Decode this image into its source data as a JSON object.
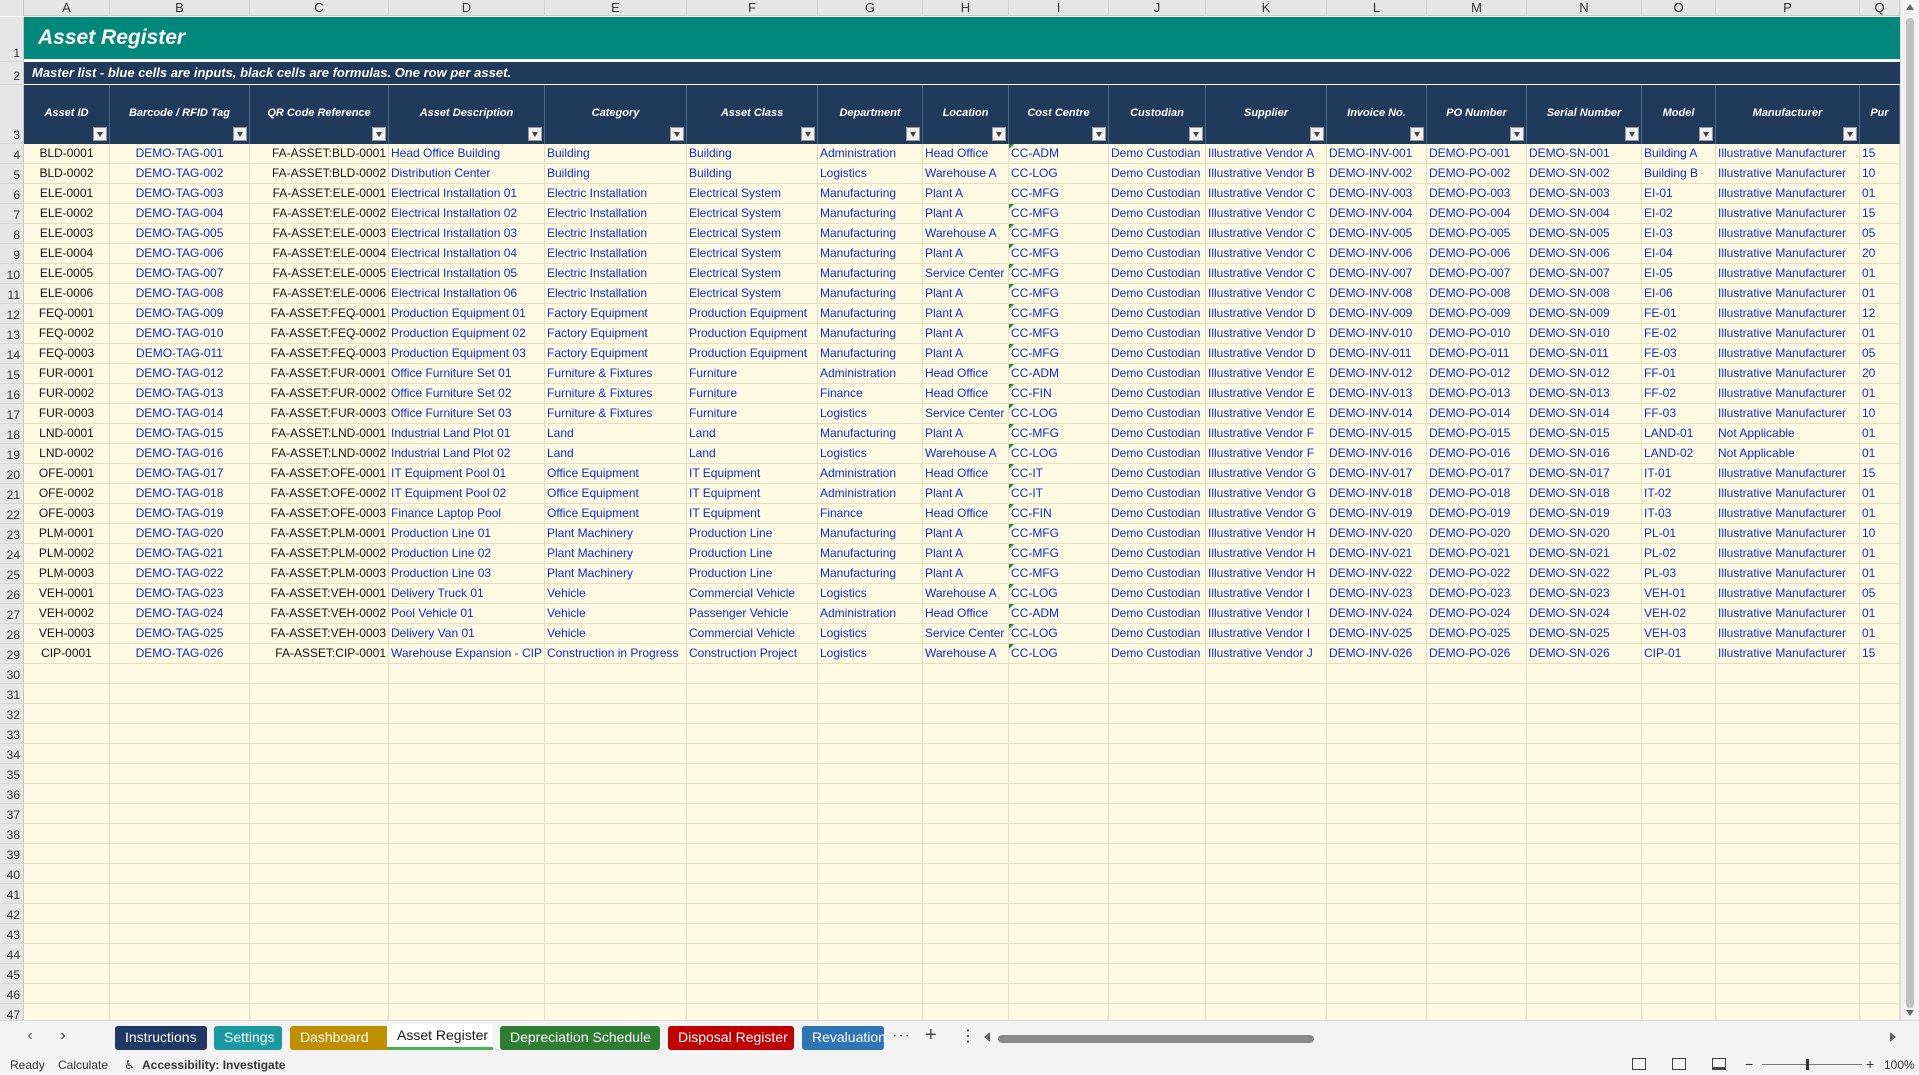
{
  "sheet": {
    "title": "Asset Register",
    "subtitle": "Master list - blue cells are inputs, black cells are formulas. One row per asset.",
    "column_letters": [
      "A",
      "B",
      "C",
      "D",
      "E",
      "F",
      "G",
      "H",
      "I",
      "J",
      "K",
      "L",
      "M",
      "N",
      "O",
      "P",
      "Q"
    ],
    "headers": [
      "Asset ID",
      "Barcode / RFID Tag",
      "QR Code Reference",
      "Asset Description",
      "Category",
      "Asset Class",
      "Department",
      "Location",
      "Cost Centre",
      "Custodian",
      "Supplier",
      "Invoice No.",
      "PO Number",
      "Serial Number",
      "Model",
      "Manufacturer",
      "Pur"
    ],
    "row_numbers": [
      "1",
      "2",
      "3",
      "4",
      "5",
      "6",
      "7",
      "8",
      "9",
      "10",
      "11",
      "12",
      "13",
      "14",
      "15",
      "16",
      "17",
      "18",
      "19",
      "20",
      "21",
      "22",
      "23",
      "24",
      "25",
      "26",
      "27",
      "28",
      "29",
      "30",
      "31",
      "32",
      "33",
      "34",
      "35",
      "36",
      "37",
      "38",
      "39",
      "40",
      "41",
      "42",
      "43",
      "44",
      "45",
      "46",
      "47"
    ],
    "rows": [
      [
        "BLD-0001",
        "DEMO-TAG-001",
        "FA-ASSET:BLD-0001",
        "Head Office Building",
        "Building",
        "Building",
        "Administration",
        "Head Office",
        "CC-ADM",
        "Demo Custodian",
        "Illustrative Vendor A",
        "DEMO-INV-001",
        "DEMO-PO-001",
        "DEMO-SN-001",
        "Building A",
        "Illustrative Manufacturer",
        "15"
      ],
      [
        "BLD-0002",
        "DEMO-TAG-002",
        "FA-ASSET:BLD-0002",
        "Distribution Center",
        "Building",
        "Building",
        "Logistics",
        "Warehouse A",
        "CC-LOG",
        "Demo Custodian",
        "Illustrative Vendor B",
        "DEMO-INV-002",
        "DEMO-PO-002",
        "DEMO-SN-002",
        "Building B",
        "Illustrative Manufacturer",
        "10"
      ],
      [
        "ELE-0001",
        "DEMO-TAG-003",
        "FA-ASSET:ELE-0001",
        "Electrical Installation 01",
        "Electric Installation",
        "Electrical System",
        "Manufacturing",
        "Plant A",
        "CC-MFG",
        "Demo Custodian",
        "Illustrative Vendor C",
        "DEMO-INV-003",
        "DEMO-PO-003",
        "DEMO-SN-003",
        "EI-01",
        "Illustrative Manufacturer",
        "01"
      ],
      [
        "ELE-0002",
        "DEMO-TAG-004",
        "FA-ASSET:ELE-0002",
        "Electrical Installation 02",
        "Electric Installation",
        "Electrical System",
        "Manufacturing",
        "Plant A",
        "CC-MFG",
        "Demo Custodian",
        "Illustrative Vendor C",
        "DEMO-INV-004",
        "DEMO-PO-004",
        "DEMO-SN-004",
        "EI-02",
        "Illustrative Manufacturer",
        "15"
      ],
      [
        "ELE-0003",
        "DEMO-TAG-005",
        "FA-ASSET:ELE-0003",
        "Electrical Installation 03",
        "Electric Installation",
        "Electrical System",
        "Manufacturing",
        "Warehouse A",
        "CC-MFG",
        "Demo Custodian",
        "Illustrative Vendor C",
        "DEMO-INV-005",
        "DEMO-PO-005",
        "DEMO-SN-005",
        "EI-03",
        "Illustrative Manufacturer",
        "05"
      ],
      [
        "ELE-0004",
        "DEMO-TAG-006",
        "FA-ASSET:ELE-0004",
        "Electrical Installation 04",
        "Electric Installation",
        "Electrical System",
        "Manufacturing",
        "Plant A",
        "CC-MFG",
        "Demo Custodian",
        "Illustrative Vendor C",
        "DEMO-INV-006",
        "DEMO-PO-006",
        "DEMO-SN-006",
        "EI-04",
        "Illustrative Manufacturer",
        "20"
      ],
      [
        "ELE-0005",
        "DEMO-TAG-007",
        "FA-ASSET:ELE-0005",
        "Electrical Installation 05",
        "Electric Installation",
        "Electrical System",
        "Manufacturing",
        "Service Center",
        "CC-MFG",
        "Demo Custodian",
        "Illustrative Vendor C",
        "DEMO-INV-007",
        "DEMO-PO-007",
        "DEMO-SN-007",
        "EI-05",
        "Illustrative Manufacturer",
        "01"
      ],
      [
        "ELE-0006",
        "DEMO-TAG-008",
        "FA-ASSET:ELE-0006",
        "Electrical Installation 06",
        "Electric Installation",
        "Electrical System",
        "Manufacturing",
        "Plant A",
        "CC-MFG",
        "Demo Custodian",
        "Illustrative Vendor C",
        "DEMO-INV-008",
        "DEMO-PO-008",
        "DEMO-SN-008",
        "EI-06",
        "Illustrative Manufacturer",
        "01"
      ],
      [
        "FEQ-0001",
        "DEMO-TAG-009",
        "FA-ASSET:FEQ-0001",
        "Production Equipment 01",
        "Factory Equipment",
        "Production Equipment",
        "Manufacturing",
        "Plant A",
        "CC-MFG",
        "Demo Custodian",
        "Illustrative Vendor D",
        "DEMO-INV-009",
        "DEMO-PO-009",
        "DEMO-SN-009",
        "FE-01",
        "Illustrative Manufacturer",
        "12"
      ],
      [
        "FEQ-0002",
        "DEMO-TAG-010",
        "FA-ASSET:FEQ-0002",
        "Production Equipment 02",
        "Factory Equipment",
        "Production Equipment",
        "Manufacturing",
        "Plant A",
        "CC-MFG",
        "Demo Custodian",
        "Illustrative Vendor D",
        "DEMO-INV-010",
        "DEMO-PO-010",
        "DEMO-SN-010",
        "FE-02",
        "Illustrative Manufacturer",
        "01"
      ],
      [
        "FEQ-0003",
        "DEMO-TAG-011",
        "FA-ASSET:FEQ-0003",
        "Production Equipment 03",
        "Factory Equipment",
        "Production Equipment",
        "Manufacturing",
        "Plant A",
        "CC-MFG",
        "Demo Custodian",
        "Illustrative Vendor D",
        "DEMO-INV-011",
        "DEMO-PO-011",
        "DEMO-SN-011",
        "FE-03",
        "Illustrative Manufacturer",
        "05"
      ],
      [
        "FUR-0001",
        "DEMO-TAG-012",
        "FA-ASSET:FUR-0001",
        "Office Furniture Set 01",
        "Furniture & Fixtures",
        "Furniture",
        "Administration",
        "Head Office",
        "CC-ADM",
        "Demo Custodian",
        "Illustrative Vendor E",
        "DEMO-INV-012",
        "DEMO-PO-012",
        "DEMO-SN-012",
        "FF-01",
        "Illustrative Manufacturer",
        "20"
      ],
      [
        "FUR-0002",
        "DEMO-TAG-013",
        "FA-ASSET:FUR-0002",
        "Office Furniture Set 02",
        "Furniture & Fixtures",
        "Furniture",
        "Finance",
        "Head Office",
        "CC-FIN",
        "Demo Custodian",
        "Illustrative Vendor E",
        "DEMO-INV-013",
        "DEMO-PO-013",
        "DEMO-SN-013",
        "FF-02",
        "Illustrative Manufacturer",
        "01"
      ],
      [
        "FUR-0003",
        "DEMO-TAG-014",
        "FA-ASSET:FUR-0003",
        "Office Furniture Set 03",
        "Furniture & Fixtures",
        "Furniture",
        "Logistics",
        "Service Center",
        "CC-LOG",
        "Demo Custodian",
        "Illustrative Vendor E",
        "DEMO-INV-014",
        "DEMO-PO-014",
        "DEMO-SN-014",
        "FF-03",
        "Illustrative Manufacturer",
        "10"
      ],
      [
        "LND-0001",
        "DEMO-TAG-015",
        "FA-ASSET:LND-0001",
        "Industrial Land Plot 01",
        "Land",
        "Land",
        "Manufacturing",
        "Plant A",
        "CC-MFG",
        "Demo Custodian",
        "Illustrative Vendor F",
        "DEMO-INV-015",
        "DEMO-PO-015",
        "DEMO-SN-015",
        "LAND-01",
        "Not Applicable",
        "01"
      ],
      [
        "LND-0002",
        "DEMO-TAG-016",
        "FA-ASSET:LND-0002",
        "Industrial Land Plot 02",
        "Land",
        "Land",
        "Logistics",
        "Warehouse A",
        "CC-LOG",
        "Demo Custodian",
        "Illustrative Vendor F",
        "DEMO-INV-016",
        "DEMO-PO-016",
        "DEMO-SN-016",
        "LAND-02",
        "Not Applicable",
        "01"
      ],
      [
        "OFE-0001",
        "DEMO-TAG-017",
        "FA-ASSET:OFE-0001",
        "IT Equipment Pool 01",
        "Office Equipment",
        "IT Equipment",
        "Administration",
        "Head Office",
        "CC-IT",
        "Demo Custodian",
        "Illustrative Vendor G",
        "DEMO-INV-017",
        "DEMO-PO-017",
        "DEMO-SN-017",
        "IT-01",
        "Illustrative Manufacturer",
        "15"
      ],
      [
        "OFE-0002",
        "DEMO-TAG-018",
        "FA-ASSET:OFE-0002",
        "IT Equipment Pool 02",
        "Office Equipment",
        "IT Equipment",
        "Administration",
        "Plant A",
        "CC-IT",
        "Demo Custodian",
        "Illustrative Vendor G",
        "DEMO-INV-018",
        "DEMO-PO-018",
        "DEMO-SN-018",
        "IT-02",
        "Illustrative Manufacturer",
        "01"
      ],
      [
        "OFE-0003",
        "DEMO-TAG-019",
        "FA-ASSET:OFE-0003",
        "Finance Laptop Pool",
        "Office Equipment",
        "IT Equipment",
        "Finance",
        "Head Office",
        "CC-FIN",
        "Demo Custodian",
        "Illustrative Vendor G",
        "DEMO-INV-019",
        "DEMO-PO-019",
        "DEMO-SN-019",
        "IT-03",
        "Illustrative Manufacturer",
        "01"
      ],
      [
        "PLM-0001",
        "DEMO-TAG-020",
        "FA-ASSET:PLM-0001",
        "Production Line 01",
        "Plant Machinery",
        "Production Line",
        "Manufacturing",
        "Plant A",
        "CC-MFG",
        "Demo Custodian",
        "Illustrative Vendor H",
        "DEMO-INV-020",
        "DEMO-PO-020",
        "DEMO-SN-020",
        "PL-01",
        "Illustrative Manufacturer",
        "10"
      ],
      [
        "PLM-0002",
        "DEMO-TAG-021",
        "FA-ASSET:PLM-0002",
        "Production Line 02",
        "Plant Machinery",
        "Production Line",
        "Manufacturing",
        "Plant A",
        "CC-MFG",
        "Demo Custodian",
        "Illustrative Vendor H",
        "DEMO-INV-021",
        "DEMO-PO-021",
        "DEMO-SN-021",
        "PL-02",
        "Illustrative Manufacturer",
        "01"
      ],
      [
        "PLM-0003",
        "DEMO-TAG-022",
        "FA-ASSET:PLM-0003",
        "Production Line 03",
        "Plant Machinery",
        "Production Line",
        "Manufacturing",
        "Plant A",
        "CC-MFG",
        "Demo Custodian",
        "Illustrative Vendor H",
        "DEMO-INV-022",
        "DEMO-PO-022",
        "DEMO-SN-022",
        "PL-03",
        "Illustrative Manufacturer",
        "01"
      ],
      [
        "VEH-0001",
        "DEMO-TAG-023",
        "FA-ASSET:VEH-0001",
        "Delivery Truck 01",
        "Vehicle",
        "Commercial Vehicle",
        "Logistics",
        "Warehouse A",
        "CC-LOG",
        "Demo Custodian",
        "Illustrative Vendor I",
        "DEMO-INV-023",
        "DEMO-PO-023",
        "DEMO-SN-023",
        "VEH-01",
        "Illustrative Manufacturer",
        "05"
      ],
      [
        "VEH-0002",
        "DEMO-TAG-024",
        "FA-ASSET:VEH-0002",
        "Pool Vehicle 01",
        "Vehicle",
        "Passenger Vehicle",
        "Administration",
        "Head Office",
        "CC-ADM",
        "Demo Custodian",
        "Illustrative Vendor I",
        "DEMO-INV-024",
        "DEMO-PO-024",
        "DEMO-SN-024",
        "VEH-02",
        "Illustrative Manufacturer",
        "01"
      ],
      [
        "VEH-0003",
        "DEMO-TAG-025",
        "FA-ASSET:VEH-0003",
        "Delivery Van 01",
        "Vehicle",
        "Commercial Vehicle",
        "Logistics",
        "Service Center",
        "CC-LOG",
        "Demo Custodian",
        "Illustrative Vendor I",
        "DEMO-INV-025",
        "DEMO-PO-025",
        "DEMO-SN-025",
        "VEH-03",
        "Illustrative Manufacturer",
        "01"
      ],
      [
        "CIP-0001",
        "DEMO-TAG-026",
        "FA-ASSET:CIP-0001",
        "Warehouse Expansion - CIP",
        "Construction in Progress",
        "Construction Project",
        "Logistics",
        "Warehouse A",
        "CC-LOG",
        "Demo Custodian",
        "Illustrative Vendor J",
        "DEMO-INV-026",
        "DEMO-PO-026",
        "DEMO-SN-026",
        "CIP-01",
        "Illustrative Manufacturer",
        "15"
      ]
    ],
    "flagged_cost_centre_rows": [
      0,
      3,
      4,
      5,
      6,
      7,
      8,
      9,
      10,
      11,
      12,
      13,
      14,
      15,
      16,
      17,
      18,
      19,
      20,
      21,
      22,
      23,
      24,
      25
    ]
  },
  "tabs": [
    {
      "label": "Instructions",
      "color": "#1f3864"
    },
    {
      "label": "Settings",
      "color": "#1a9aa0"
    },
    {
      "label": "Dashboard",
      "color": "#bf8f00"
    },
    {
      "label": "Asset Register",
      "color": "#ffffff",
      "active": true
    },
    {
      "label": "Depreciation Schedule",
      "color": "#2e7d32"
    },
    {
      "label": "Disposal Register",
      "color": "#c00000"
    },
    {
      "label": "Revaluation",
      "color": "#2e75b6"
    }
  ],
  "tab_more": "···",
  "tab_add": "+",
  "tab_menu": "⋮",
  "status": {
    "ready": "Ready",
    "calculate": "Calculate",
    "accessibility": "Accessibility: Investigate",
    "zoom": "100%",
    "zoom_minus": "−",
    "zoom_plus": "+"
  },
  "colors": {
    "title_bg": "#00897b",
    "header_bg": "#1f3a5a",
    "input_text": "#0b2bd6",
    "cell_bg": "#fffbe3"
  }
}
